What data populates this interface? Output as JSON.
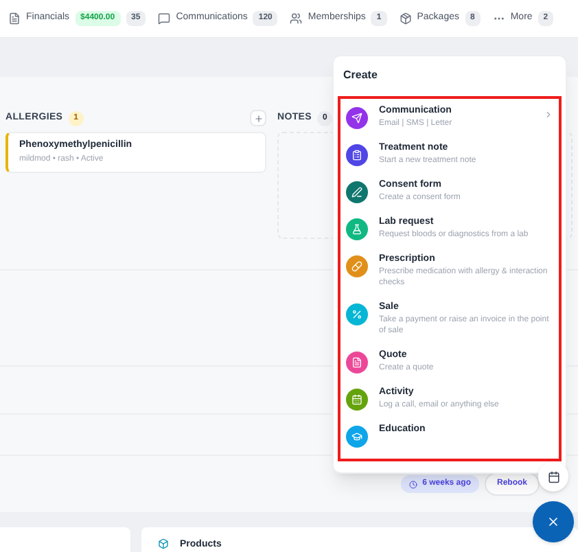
{
  "tabs": [
    {
      "label": "Financials",
      "amount": "$4400.00",
      "count": "35"
    },
    {
      "label": "Communications",
      "count": "120"
    },
    {
      "label": "Memberships",
      "count": "1"
    },
    {
      "label": "Packages",
      "count": "8"
    },
    {
      "label": "More",
      "count": "2"
    }
  ],
  "allergies": {
    "title": "ALLERGIES",
    "count": "1",
    "items": [
      {
        "name": "Phenoxymethylpenicillin",
        "detail": "mildmod • rash • Active"
      }
    ]
  },
  "notes": {
    "title": "NOTES",
    "count": "0"
  },
  "appointment": {
    "badge": "6 weeks ago",
    "button": "Rebook"
  },
  "products": {
    "title": "Products"
  },
  "create_menu": {
    "title": "Create",
    "items": [
      {
        "title": "Communication",
        "description": "Email | SMS | Letter",
        "color": "#9333ea",
        "has_submenu": true
      },
      {
        "title": "Treatment note",
        "description": "Start a new treatment note",
        "color": "#4f46e5",
        "has_submenu": false
      },
      {
        "title": "Consent form",
        "description": "Create a consent form",
        "color": "#0f766e",
        "has_submenu": false
      },
      {
        "title": "Lab request",
        "description": "Request bloods or diagnostics from a lab",
        "color": "#10b981",
        "has_submenu": false
      },
      {
        "title": "Prescription",
        "description": "Prescribe medication with allergy & interaction checks",
        "color": "#e0901a",
        "has_submenu": false
      },
      {
        "title": "Sale",
        "description": "Take a payment or raise an invoice in the point of sale",
        "color": "#06b6d4",
        "has_submenu": false
      },
      {
        "title": "Quote",
        "description": "Create a quote",
        "color": "#ec4899",
        "has_submenu": false
      },
      {
        "title": "Activity",
        "description": "Log a call, email or anything else",
        "color": "#65a30d",
        "has_submenu": false
      },
      {
        "title": "Education",
        "color": "#0ea5e9",
        "has_submenu": false
      }
    ]
  }
}
